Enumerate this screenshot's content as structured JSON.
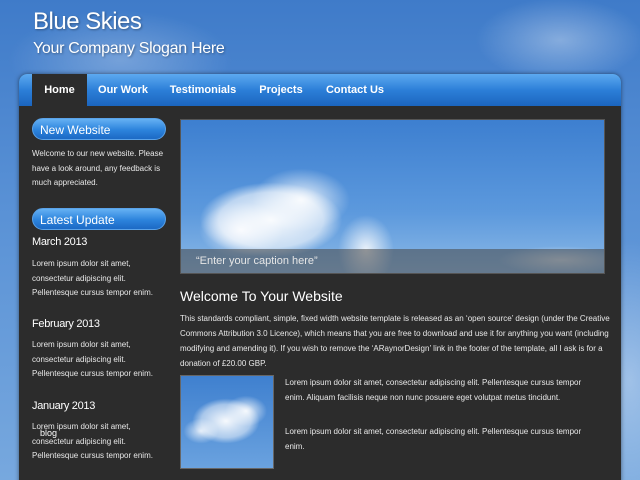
{
  "site": {
    "title": "Blue Skies",
    "slogan": "Your Company Slogan Here"
  },
  "menu": {
    "items": [
      {
        "label": "Home",
        "active": true
      },
      {
        "label": "Our Work",
        "active": false
      },
      {
        "label": "Testimonials",
        "active": false
      },
      {
        "label": "Projects",
        "active": false
      },
      {
        "label": "Contact Us",
        "active": false
      }
    ]
  },
  "sidebar": {
    "new_website": {
      "heading": "New Website",
      "text": "Welcome to our new website. Please have a look around, any feedback is much appreciated."
    },
    "latest_update": {
      "heading": "Latest Update",
      "posts": [
        {
          "date": "March 2013",
          "text": "Lorem ipsum dolor sit amet, consectetur adipiscing elit. Pellentesque cursus tempor enim."
        },
        {
          "date": "February 2013",
          "text": "Lorem ipsum dolor sit amet, consectetur adipiscing elit. Pellentesque cursus tempor enim."
        },
        {
          "date": "January 2013",
          "text": "Lorem ipsum dolor sit amet, consectetur adipiscing elit. Pellentesque cursus tempor enim."
        }
      ]
    },
    "blog_tag": "blog"
  },
  "main": {
    "banner_caption": "“Enter your caption here”",
    "welcome_title": "Welcome To Your Website",
    "intro": "This standards compliant, simple, fixed width website template is released as an ‘open source’ design (under the Creative Commons Attribution 3.0 Licence), which means that you are free to download and use it for anything you want (including modifying and amending it). If you wish to remove the ‘ARaynorDesign’ link in the footer of the template, all I ask is for a donation of £20.00 GBP.",
    "paragraphs": [
      "Lorem ipsum dolor sit amet, consectetur adipiscing elit. Pellentesque cursus tempor enim. Aliquam facilisis neque non nunc posuere eget volutpat metus tincidunt.",
      "Lorem ipsum dolor sit amet, consectetur adipiscing elit. Pellentesque cursus tempor enim."
    ]
  },
  "colors": {
    "accent": "#2c7fd8",
    "content_bg": "#2c2c2c",
    "sky": "#5a92d6"
  }
}
